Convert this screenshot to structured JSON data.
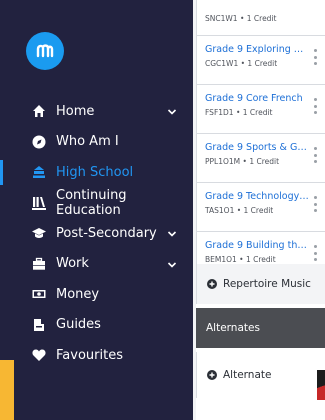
{
  "sidebar": {
    "logo_icon": "m-logo-icon",
    "items": [
      {
        "label": "Home",
        "icon": "house-icon",
        "chevron": true,
        "active": false
      },
      {
        "label": "Who Am I",
        "icon": "compass-icon",
        "chevron": false,
        "active": false
      },
      {
        "label": "High School",
        "icon": "school-icon",
        "chevron": false,
        "active": true
      },
      {
        "label": "Continuing Education",
        "icon": "institution-icon",
        "chevron": false,
        "active": false
      },
      {
        "label": "Post-Secondary",
        "icon": "graduation-cap-icon",
        "chevron": true,
        "active": false
      },
      {
        "label": "Work",
        "icon": "briefcase-icon",
        "chevron": true,
        "active": false
      },
      {
        "label": "Money",
        "icon": "money-icon",
        "chevron": false,
        "active": false
      },
      {
        "label": "Guides",
        "icon": "guide-icon",
        "chevron": false,
        "active": false
      },
      {
        "label": "Favourites",
        "icon": "heart-icon",
        "chevron": false,
        "active": false
      }
    ],
    "colors": {
      "background": "#22223f",
      "active": "#2196f3",
      "accent": "#f7b733"
    }
  },
  "courses": [
    {
      "title": "",
      "code": "SNC1W1 • 1 Credit"
    },
    {
      "title": "Grade 9 Exploring C...",
      "code": "CGC1W1 • 1 Credit"
    },
    {
      "title": "Grade 9 Core French",
      "code": "FSF1D1 • 1 Credit"
    },
    {
      "title": "Grade 9 Sports & Ga...",
      "code": "PPL1O1M • 1 Credit"
    },
    {
      "title": "Grade 9 Technology ...",
      "code": "TAS1O1 • 1 Credit"
    },
    {
      "title": "Grade 9 Building the...",
      "code": "BEM1O1 • 1 Credit"
    }
  ],
  "repertoire": {
    "label": "Repertoire Music"
  },
  "alternates": {
    "header": "Alternates",
    "add_label": "Alternate"
  }
}
